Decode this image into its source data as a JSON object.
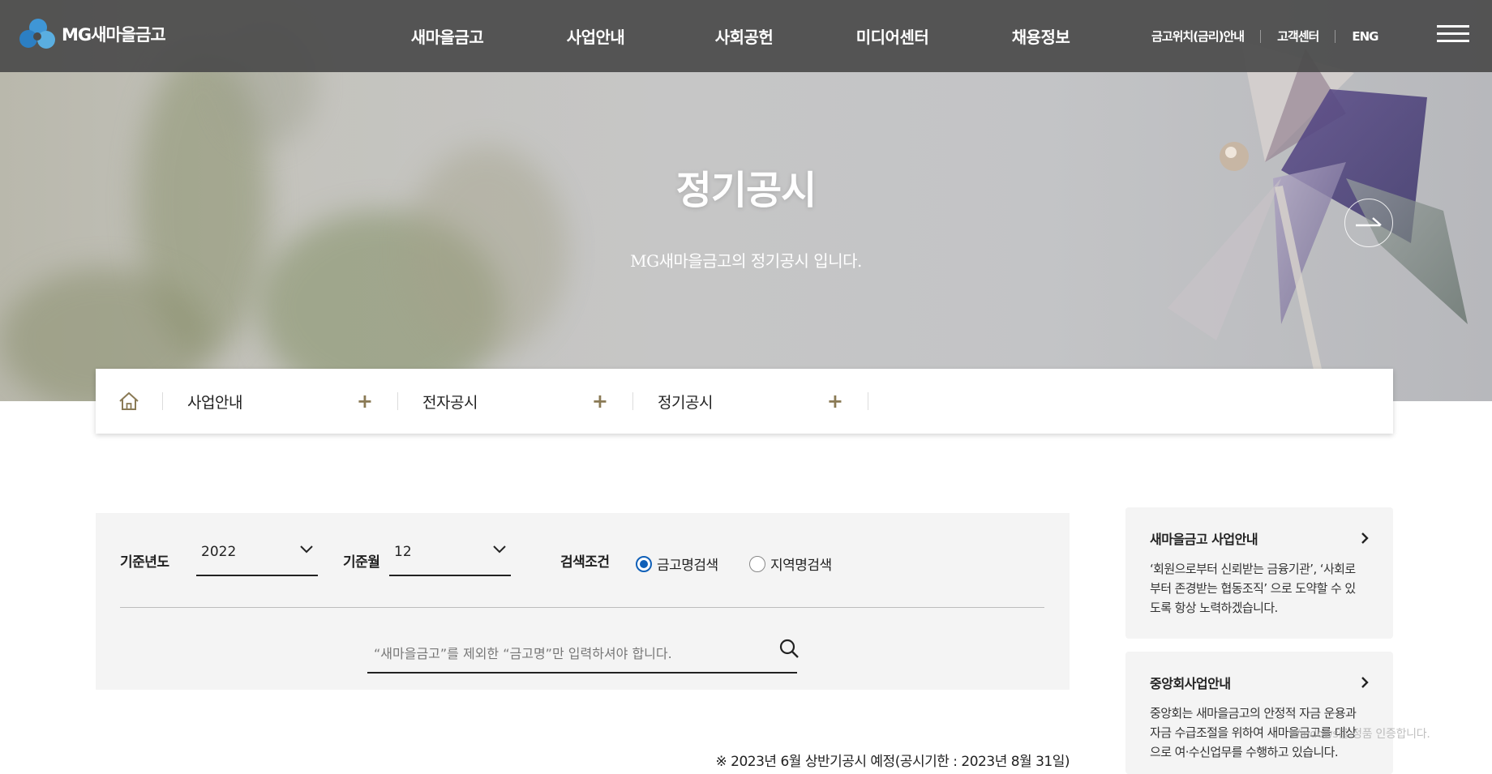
{
  "header": {
    "logo_text": "MG새마을금고",
    "nav": [
      "새마을금고",
      "사업안내",
      "사회공헌",
      "미디어센터",
      "채용정보"
    ],
    "util": [
      "금고위치(금리)안내",
      "고객센터",
      "ENG"
    ]
  },
  "hero": {
    "title": "정기공시",
    "subtitle": "MG새마을금고의 정기공시 입니다."
  },
  "breadcrumb": [
    "사업안내",
    "전자공시",
    "정기공시"
  ],
  "search": {
    "year_label": "기준년도",
    "year_value": "2022",
    "month_label": "기준월",
    "month_value": "12",
    "condition_label": "검색조건",
    "radio_name": "금고명검색",
    "radio_region": "지역명검색",
    "radio_selected": "금고명검색",
    "placeholder": "“새마을금고”를 제외한 “금고명”만 입력하셔야 합니다."
  },
  "notice": "※ 2023년 6월 상반기공시 예정(공시기한 : 2023년 8월 31일)",
  "cards": [
    {
      "title": "새마을금고 사업안내",
      "desc_lines": [
        "‘회원으로부터 신뢰받는 금융기관’, ‘사회로",
        "부터 존경받는 협동조직’ 으로 도약할 수 있",
        "도록 항상 노력하겠습니다."
      ]
    },
    {
      "title": "중앙회사업안내",
      "desc_lines": [
        "중앙회는 새마을금고의 안정적 자금 운용과",
        "자금 수급조절을 위하여 새마을금고를 대상",
        "으로 여·수신업무를 수행하고 있습니다."
      ]
    }
  ],
  "watermark": "Windows를 정품 인증합니다.",
  "colors": {
    "header_bg": "#4b4b4b",
    "accent_blue": "#1060b8",
    "plus_gold": "#8a7a55"
  }
}
